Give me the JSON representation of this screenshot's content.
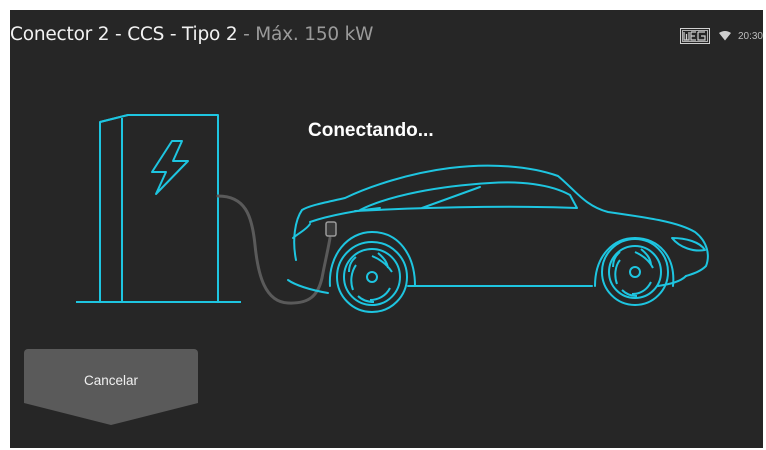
{
  "header": {
    "connector": "Conector 2",
    "separator1": " - ",
    "standard": "CCS",
    "separator2": " - ",
    "type": "Tipo 2",
    "separator3": " - ",
    "max_power": "Máx. 150 kW"
  },
  "status_bar": {
    "logo_text": "WEG",
    "logo_icon": "weg-logo",
    "wifi_icon": "wifi-icon",
    "time": "20:30"
  },
  "main": {
    "status_text": "Conectando...",
    "illustration": "charger-connected-to-car"
  },
  "actions": {
    "cancel_label": "Cancelar"
  },
  "colors": {
    "background": "#262626",
    "accent": "#1ec5e0",
    "text": "#f2f2f2",
    "muted_text": "#9a9a9a",
    "button": "#5a5a5a"
  }
}
